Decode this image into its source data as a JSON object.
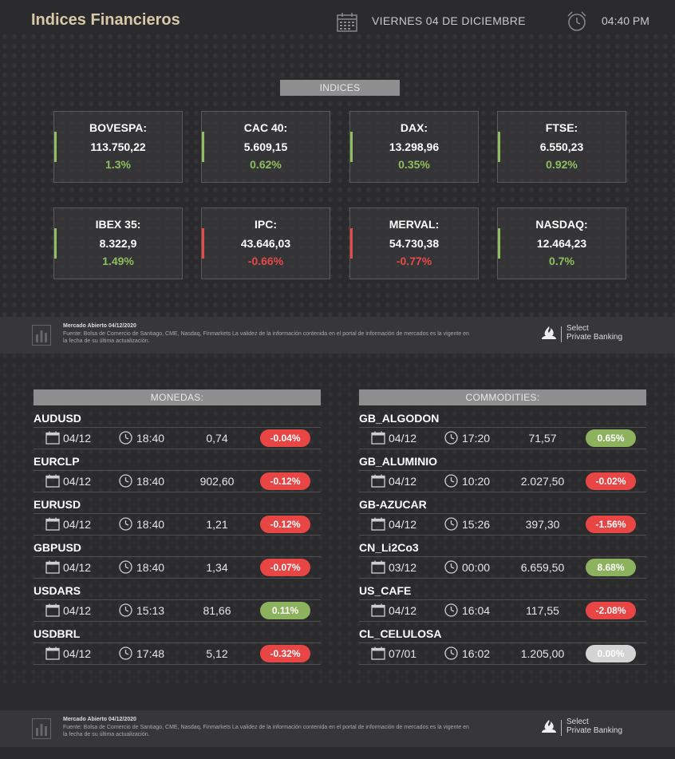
{
  "header": {
    "title": "Indices Financieros",
    "date": "VIERNES 04 DE DICIEMBRE",
    "time": "04:40 PM"
  },
  "indices": {
    "label": "INDICES",
    "items": [
      {
        "name": "BOVESPA:",
        "value": "113.750,22",
        "change": "1.3%",
        "trend": "up"
      },
      {
        "name": "CAC 40:",
        "value": "5.609,15",
        "change": "0.62%",
        "trend": "up"
      },
      {
        "name": "DAX:",
        "value": "13.298,96",
        "change": "0.35%",
        "trend": "up"
      },
      {
        "name": "FTSE:",
        "value": "6.550,23",
        "change": "0.92%",
        "trend": "up"
      },
      {
        "name": "IBEX 35:",
        "value": "8.322,9",
        "change": "1.49%",
        "trend": "up"
      },
      {
        "name": "IPC:",
        "value": "43.646,03",
        "change": "-0.66%",
        "trend": "down"
      },
      {
        "name": "MERVAL:",
        "value": "54.730,38",
        "change": "-0.77%",
        "trend": "down"
      },
      {
        "name": "NASDAQ:",
        "value": "12.464,23",
        "change": "0.7%",
        "trend": "up"
      }
    ]
  },
  "footer": {
    "title": "Mercado Abierto 04/12/2020",
    "source": "Fuente: Bolsa de Comercio de Santiago, CME, Nasdaq, Finmarkets La validez de la información contenida en el portal de información de mercados es la vigente en la fecha de su última actualización.",
    "brand_line1": "Select",
    "brand_line2": "Private Banking"
  },
  "monedas": {
    "label": "MONEDAS:",
    "rows": [
      {
        "name": "AUDUSD",
        "date": "04/12",
        "time": "18:40",
        "price": "0,74",
        "change": "-0.04%",
        "trend": "down"
      },
      {
        "name": "EURCLP",
        "date": "04/12",
        "time": "18:40",
        "price": "902,60",
        "change": "-0.12%",
        "trend": "down"
      },
      {
        "name": "EURUSD",
        "date": "04/12",
        "time": "18:40",
        "price": "1,21",
        "change": "-0.12%",
        "trend": "down"
      },
      {
        "name": "GBPUSD",
        "date": "04/12",
        "time": "18:40",
        "price": "1,34",
        "change": "-0.07%",
        "trend": "down"
      },
      {
        "name": "USDARS",
        "date": "04/12",
        "time": "15:13",
        "price": "81,66",
        "change": "0.11%",
        "trend": "up"
      },
      {
        "name": "USDBRL",
        "date": "04/12",
        "time": "17:48",
        "price": "5,12",
        "change": "-0.32%",
        "trend": "down"
      }
    ]
  },
  "commodities": {
    "label": "COMMODITIES:",
    "rows": [
      {
        "name": "GB_ALGODON",
        "date": "04/12",
        "time": "17:20",
        "price": "71,57",
        "change": "0.65%",
        "trend": "up"
      },
      {
        "name": "GB_ALUMINIO",
        "date": "04/12",
        "time": "10:20",
        "price": "2.027,50",
        "change": "-0.02%",
        "trend": "down"
      },
      {
        "name": "GB-AZUCAR",
        "date": "04/12",
        "time": "15:26",
        "price": "397,30",
        "change": "-1.56%",
        "trend": "down"
      },
      {
        "name": "CN_Li2Co3",
        "date": "03/12",
        "time": "00:00",
        "price": "6.659,50",
        "change": "8.68%",
        "trend": "up"
      },
      {
        "name": "US_CAFE",
        "date": "04/12",
        "time": "16:04",
        "price": "117,55",
        "change": "-2.08%",
        "trend": "down"
      },
      {
        "name": "CL_CELULOSA",
        "date": "07/01",
        "time": "16:02",
        "price": "1.205,00",
        "change": "0.00%",
        "trend": "flat"
      }
    ]
  },
  "colors": {
    "up": "#8fbf5f",
    "down": "#e74a4a",
    "flat": "#d3d3d3",
    "title": "#d8c9a8"
  }
}
